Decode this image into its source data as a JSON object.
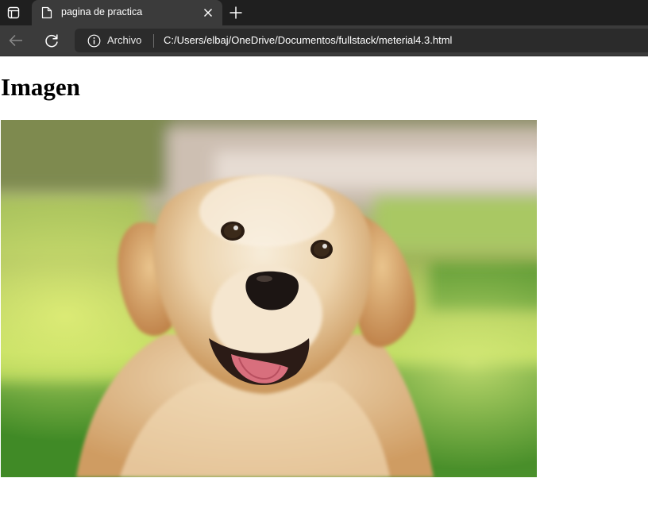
{
  "browser": {
    "tab": {
      "title": "pagina de practica"
    },
    "toolbar": {
      "site_label": "Archivo",
      "url": "C:/Users/elbaj/OneDrive/Documentos/fullstack/meterial4.3.html"
    },
    "icons": {
      "tab_actions": "tab-actions-icon",
      "favicon": "page-file-icon",
      "close": "close-icon",
      "new_tab": "plus-icon",
      "back": "back-arrow-icon",
      "reload": "reload-icon",
      "info": "info-icon"
    }
  },
  "page": {
    "heading": "Imagen",
    "image": {
      "subject": "golden retriever dog"
    }
  },
  "colors": {
    "tabstrip": "#1f1f1f",
    "toolbar": "#3b3b3b",
    "omnibox": "#2b2b2b",
    "page_background": "#ffffff"
  }
}
